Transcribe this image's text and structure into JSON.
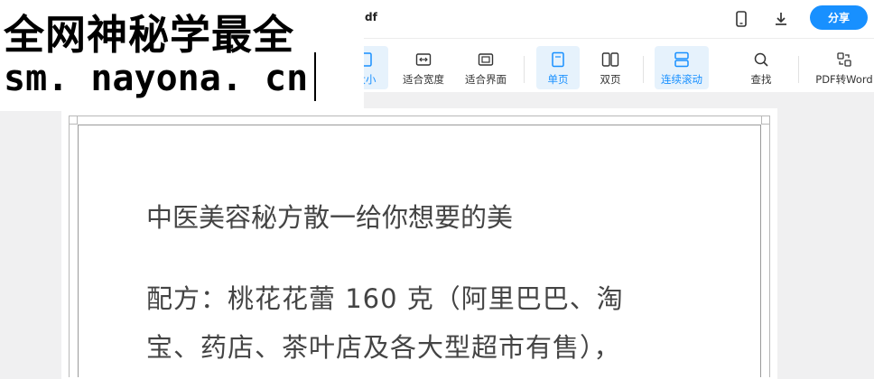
{
  "header": {
    "file_name_tail": "df",
    "share_label": "分享",
    "icons": [
      "mobile-icon",
      "download-icon"
    ]
  },
  "toolbar": {
    "items": [
      {
        "label": "大小",
        "icon": "actual-size-icon",
        "active": true
      },
      {
        "label": "适合宽度",
        "icon": "fit-width-icon",
        "active": false
      },
      {
        "label": "适合界面",
        "icon": "fit-page-icon",
        "active": false
      },
      {
        "label": "单页",
        "icon": "single-page-icon",
        "active": true
      },
      {
        "label": "双页",
        "icon": "double-page-icon",
        "active": false
      },
      {
        "label": "连续滚动",
        "icon": "continuous-scroll-icon",
        "active": true
      },
      {
        "label": "查找",
        "icon": "search-icon",
        "active": false
      },
      {
        "label": "PDF转Word",
        "icon": "convert-icon",
        "active": false
      }
    ]
  },
  "document": {
    "title": "中医美容秘方散一给你想要的美",
    "line1": "配方：桃花花蕾 160 克（阿里巴巴、淘",
    "line2": "宝、药店、茶叶店及各大型超市有售），"
  },
  "watermark": {
    "line1": "全网神秘学最全",
    "line2": "sm. nayona. cn"
  },
  "colors": {
    "accent": "#1890ff",
    "active_bg": "#e6f2fc",
    "background": "#f0f0f1"
  }
}
